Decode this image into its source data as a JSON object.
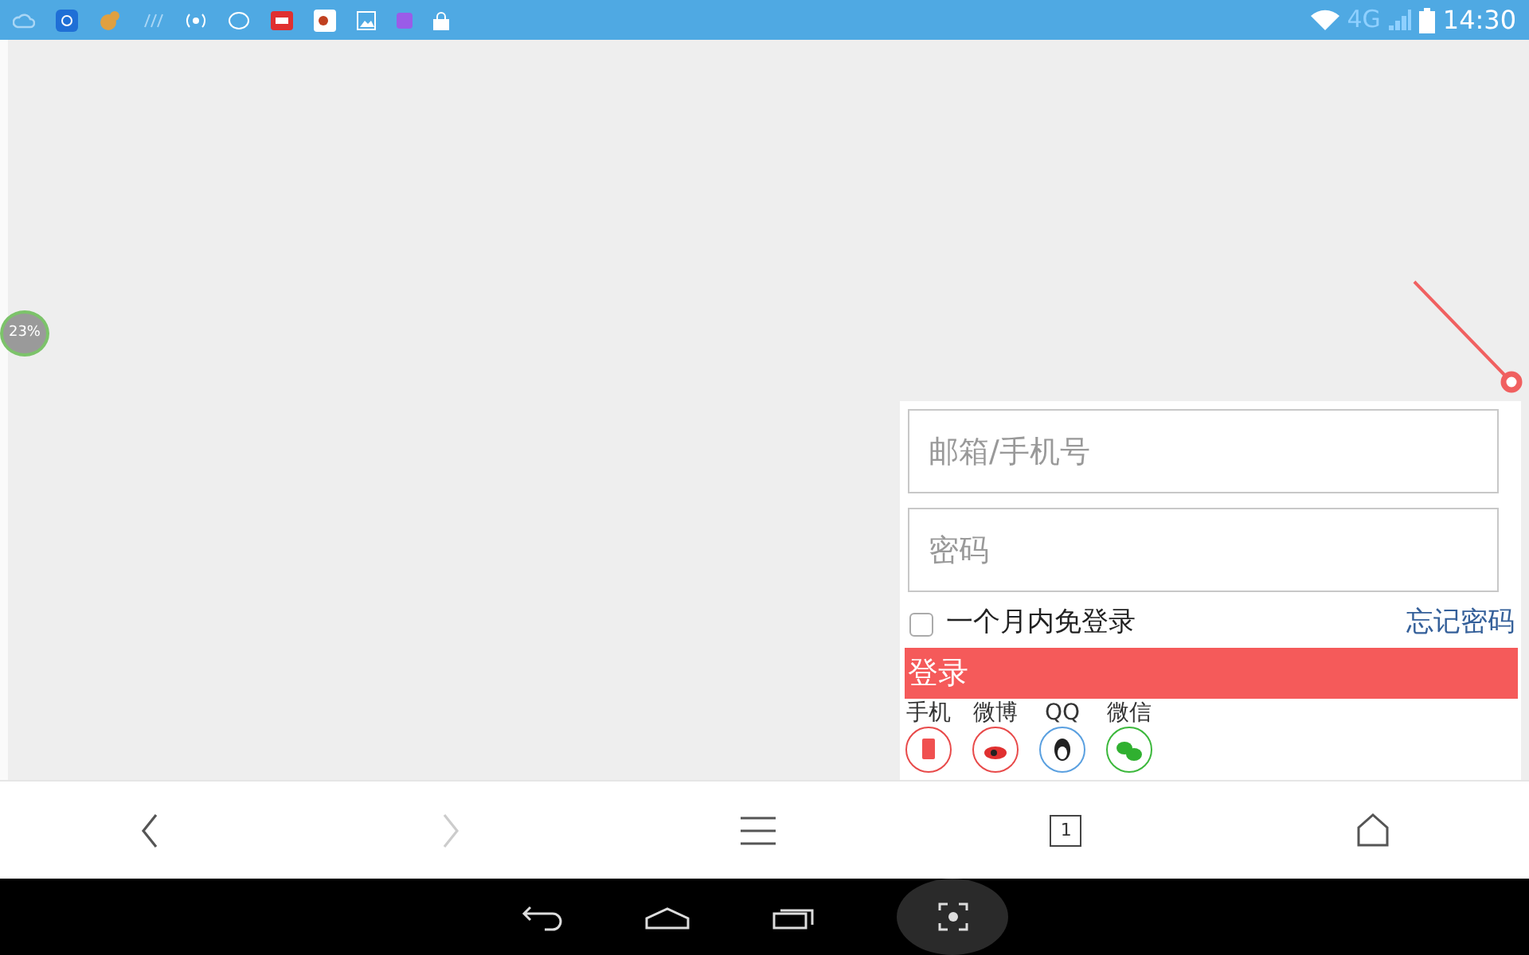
{
  "status_bar": {
    "network": "4G",
    "time": "14:30"
  },
  "battery_bubble": {
    "text": "23%"
  },
  "login": {
    "account_field": {
      "placeholder": "邮箱/手机号"
    },
    "password_field": {
      "placeholder": "密码"
    },
    "remember": {
      "label": "一个月内免登录",
      "checked": false
    },
    "forgot_link": "忘记密码",
    "submit_button": "登录",
    "social": [
      {
        "label": "手机",
        "color": "#e84a4a"
      },
      {
        "label": "微博",
        "color": "#e84a4a"
      },
      {
        "label": "QQ",
        "color": "#5aa0e0"
      },
      {
        "label": "微信",
        "color": "#3cb83c"
      }
    ]
  },
  "browser_toolbar": {
    "back_disabled": false,
    "forward_disabled": true,
    "tab_count": "1"
  }
}
